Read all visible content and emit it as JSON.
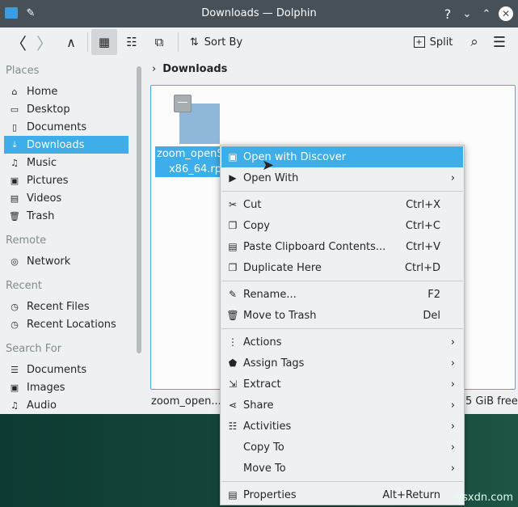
{
  "window": {
    "title": "Downloads — Dolphin"
  },
  "toolbar": {
    "sort_by": "Sort By",
    "split": "Split"
  },
  "sidebar": {
    "places_header": "Places",
    "places": [
      {
        "label": "Home",
        "icon": "home-icon"
      },
      {
        "label": "Desktop",
        "icon": "desktop-icon"
      },
      {
        "label": "Documents",
        "icon": "documents-icon"
      },
      {
        "label": "Downloads",
        "icon": "downloads-icon"
      },
      {
        "label": "Music",
        "icon": "music-icon"
      },
      {
        "label": "Pictures",
        "icon": "pictures-icon"
      },
      {
        "label": "Videos",
        "icon": "videos-icon"
      },
      {
        "label": "Trash",
        "icon": "trash-icon"
      }
    ],
    "remote_header": "Remote",
    "remote": [
      {
        "label": "Network"
      }
    ],
    "recent_header": "Recent",
    "recent": [
      {
        "label": "Recent Files"
      },
      {
        "label": "Recent Locations"
      }
    ],
    "search_header": "Search For",
    "search": [
      {
        "label": "Documents"
      },
      {
        "label": "Images"
      },
      {
        "label": "Audio"
      }
    ]
  },
  "breadcrumb": {
    "current": "Downloads"
  },
  "file": {
    "name_line1": "zoom_openS",
    "name_line2": "x86_64.rp"
  },
  "status": {
    "left": "zoom_open...5",
    "right": "5 GiB free"
  },
  "menu": {
    "items": [
      {
        "label": "Open with Discover",
        "shortcut": ""
      },
      {
        "label": "Open With",
        "shortcut": ""
      },
      {
        "label": "Cut",
        "shortcut": "Ctrl+X"
      },
      {
        "label": "Copy",
        "shortcut": "Ctrl+C"
      },
      {
        "label": "Paste Clipboard Contents...",
        "shortcut": "Ctrl+V"
      },
      {
        "label": "Duplicate Here",
        "shortcut": "Ctrl+D"
      },
      {
        "label": "Rename...",
        "shortcut": "F2"
      },
      {
        "label": "Move to Trash",
        "shortcut": "Del"
      },
      {
        "label": "Actions"
      },
      {
        "label": "Assign Tags"
      },
      {
        "label": "Extract"
      },
      {
        "label": "Share"
      },
      {
        "label": "Activities"
      },
      {
        "label": "Copy To"
      },
      {
        "label": "Move To"
      },
      {
        "label": "Properties",
        "shortcut": "Alt+Return"
      }
    ]
  },
  "watermark": "wsxdn.com",
  "colors": {
    "accent": "#3daee9",
    "titlebar": "#475057"
  }
}
